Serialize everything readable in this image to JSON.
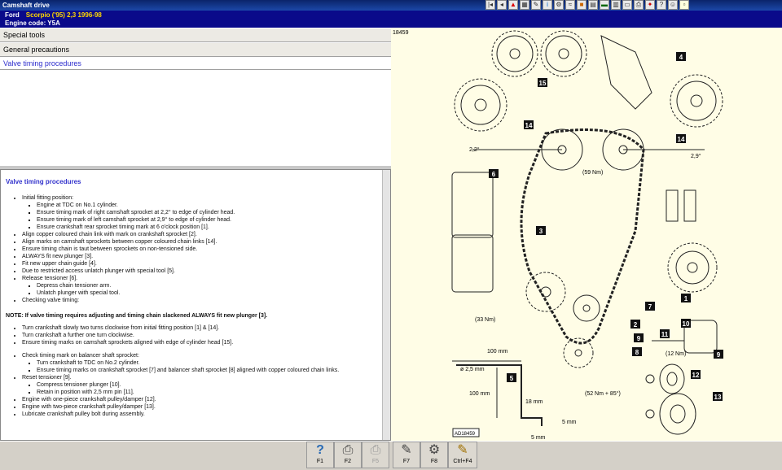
{
  "window": {
    "title": "Camshaft drive"
  },
  "toolbar_icons": [
    "nav-first-icon",
    "nav-prev-icon",
    "warning-icon",
    "table-icon",
    "tool-icon",
    "info-icon",
    "gear-icon",
    "wiring-icon",
    "engine-icon",
    "calendar-icon",
    "car-icon",
    "chart-icon",
    "document-icon",
    "print-icon",
    "settings-icon",
    "help-icon",
    "user-icon",
    "note-icon"
  ],
  "header": {
    "make": "Ford",
    "model": "Scorpio ('95) 2,3  1996-98",
    "engine_code": "Engine code: Y5A"
  },
  "menu": {
    "special_tools": "Special tools",
    "general_precautions": "General precautions",
    "valve_timing": "Valve timing procedures"
  },
  "doc": {
    "title": "Valve timing procedures",
    "initial": "Initial fitting position:",
    "s1": "Engine at TDC on No.1 cylinder.",
    "s2": "Ensure timing mark of right camshaft sprocket at 2,2° to edge of cylinder head.",
    "s3": "Ensure timing mark of left camshaft sprocket at 2,9° to edge of cylinder head.",
    "s4": "Ensure crankshaft rear sprocket timing mark at 6 o'clock position [1].",
    "a1": "Align copper coloured chain link with mark on crankshaft sprocket [2].",
    "a2": "Align marks on camshaft sprockets between copper coloured chain links [14].",
    "a3": "Ensure timing chain is taut between sprockets on non-tensioned side.",
    "a4": "ALWAYS fit new plunger [3].",
    "a5": "Fit new upper chain guide [4].",
    "a6": "Due to restricted access unlatch plunger with special tool [5].",
    "a7": "Release tensioner [6].",
    "a7s1": "Depress chain tensioner arm.",
    "a7s2": "Unlatch plunger with special tool.",
    "a8": "Checking valve timing:",
    "note": "NOTE: If valve timing requires adjusting and timing chain slackened ALWAYS fit new plunger [3].",
    "b1": "Turn crankshaft slowly two turns clockwise from initial fitting position [1] & [14].",
    "b2": "Turn crankshaft a further one turn clockwise.",
    "b3": "Ensure timing marks on camshaft sprockets aligned with edge of cylinder head [15].",
    "c1": "Check timing mark on balancer shaft sprocket:",
    "c1s1": "Turn crankshaft to TDC on No.2 cylinder.",
    "c1s2": "Ensure timing marks on crankshaft sprocket [7] and balancer shaft sprocket [8] aligned with copper coloured chain links.",
    "c2": "Reset tensioner [9].",
    "c2s1": "Compress tensioner plunger [10].",
    "c2s2": "Retain in position with 2,5 mm pin [11].",
    "c3": "Engine with one-piece crankshaft pulley/damper [12].",
    "c4": "Engine with two-piece crankshaft pulley/damper [13].",
    "c5": "Lubricate crankshaft pulley bolt during assembly."
  },
  "diagram": {
    "ref": "18459",
    "code": "AD18459",
    "callouts": [
      "1",
      "2",
      "3",
      "4",
      "5",
      "6",
      "7",
      "8",
      "9",
      "10",
      "11",
      "12",
      "13",
      "14",
      "14",
      "15"
    ],
    "torque_59": "(59 Nm)",
    "torque_33": "(33 Nm)",
    "torque_12": "(12 Nm)",
    "torque_52": "(52 Nm + 85°)",
    "angle_left": "2,2°",
    "angle_right": "2,9°",
    "dim_phi": "ø 2,5 mm",
    "dim_100a": "100 mm",
    "dim_100b": "100 mm",
    "dim_18": "18 mm",
    "dim_5a": "5 mm",
    "dim_5b": "5 mm"
  },
  "fkeys": [
    {
      "label": "F1",
      "icon": "?"
    },
    {
      "label": "F2",
      "icon": "⎙"
    },
    {
      "label": "F5",
      "icon": "⎙"
    },
    {
      "label": "F7",
      "icon": "✎"
    },
    {
      "label": "F8",
      "icon": "⚙"
    },
    {
      "label": "Ctrl+F4",
      "icon": "✎"
    }
  ]
}
